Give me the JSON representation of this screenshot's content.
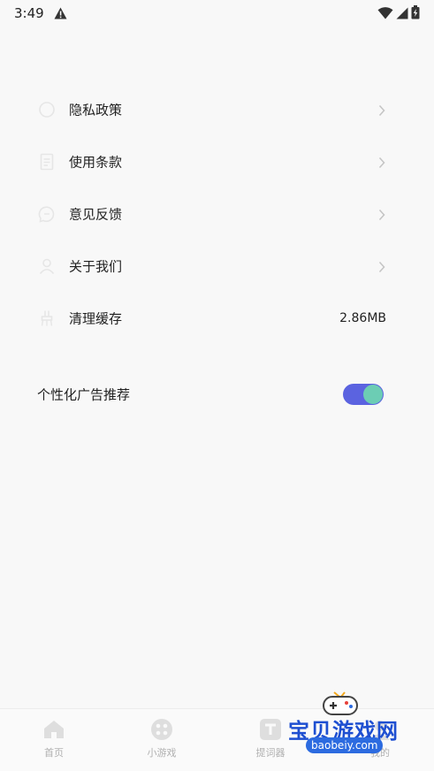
{
  "status_bar": {
    "time": "3:49",
    "icons": [
      "warning-icon",
      "wifi-icon",
      "signal-icon",
      "battery-charging-icon"
    ]
  },
  "settings": {
    "items": [
      {
        "label": "隐私政策",
        "icon": "shield-icon",
        "trailing": "chevron-right-icon"
      },
      {
        "label": "使用条款",
        "icon": "document-icon",
        "trailing": "chevron-right-icon"
      },
      {
        "label": "意见反馈",
        "icon": "feedback-icon",
        "trailing": "chevron-right-icon"
      },
      {
        "label": "关于我们",
        "icon": "person-icon",
        "trailing": "chevron-right-icon"
      },
      {
        "label": "清理缓存",
        "icon": "broom-icon",
        "value": "2.86MB"
      }
    ],
    "ad_toggle": {
      "label": "个性化广告推荐",
      "enabled": true
    }
  },
  "bottom_nav": {
    "tabs": [
      {
        "label": "首页",
        "icon": "home-icon"
      },
      {
        "label": "小游戏",
        "icon": "game-icon"
      },
      {
        "label": "提词器",
        "icon": "teleprompter-icon"
      },
      {
        "label": "我的",
        "icon": "profile-icon"
      }
    ]
  },
  "watermark": {
    "title": "宝贝游戏网",
    "url": "baobeiy.com"
  },
  "colors": {
    "background": "#f8f8f8",
    "text": "#222222",
    "icon_faint": "#e6e6e6",
    "chevron": "#c4c4c4",
    "toggle_track": "#5b63e0",
    "toggle_knob": "#6ccdb4",
    "nav_inactive": "#b0b0b0"
  }
}
